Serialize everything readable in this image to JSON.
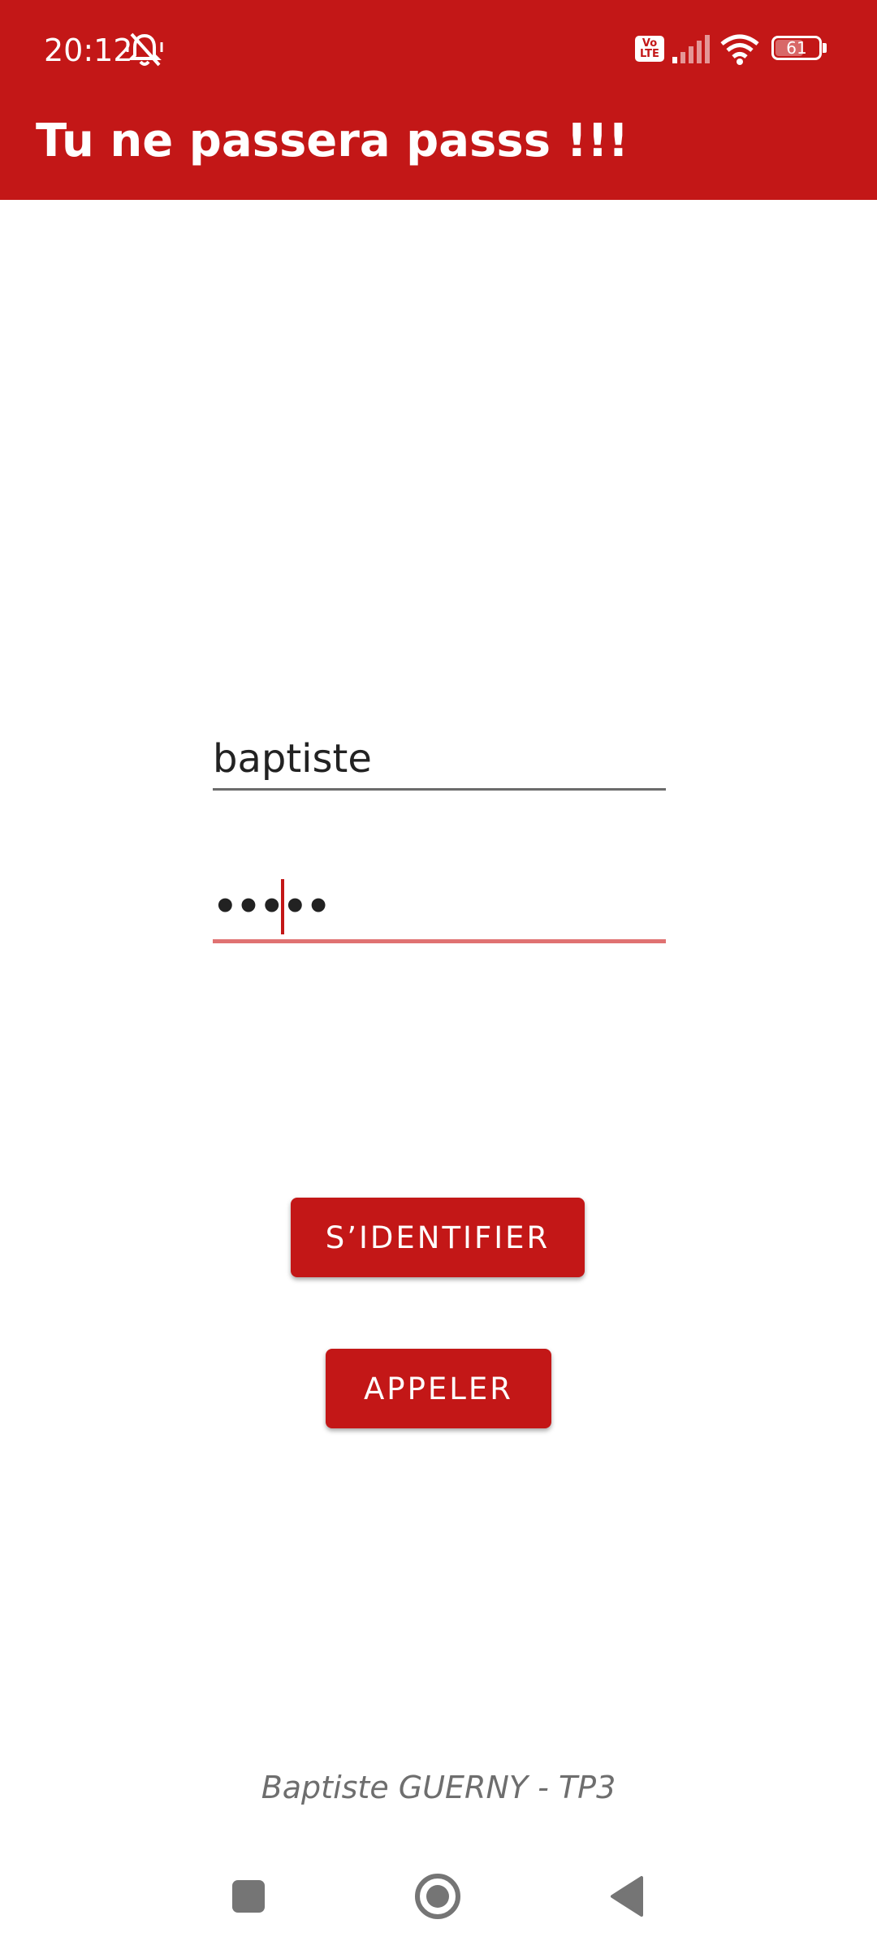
{
  "status_bar": {
    "time": "20:12",
    "battery": "61",
    "volte_label": "Vo LTE",
    "icons": [
      "bell-muted-icon",
      "volte-icon",
      "signal-icon",
      "wifi-icon",
      "battery-icon"
    ]
  },
  "app_bar": {
    "title": "Tu ne passera passs !!!"
  },
  "login_form": {
    "username_value": "baptiste",
    "password_value": "•••••"
  },
  "buttons": {
    "login_label": "S’IDENTIFIER",
    "call_label": "APPELER"
  },
  "footer": {
    "text": "Baptiste GUERNY - TP3"
  },
  "nav_bar": {
    "icons": [
      "recents-square-icon",
      "home-circle-icon",
      "back-triangle-icon"
    ]
  },
  "colors": {
    "primary": "#c31717",
    "accent_line": "#e07272",
    "text": "#222222",
    "footer_text": "#6e6e6e"
  }
}
